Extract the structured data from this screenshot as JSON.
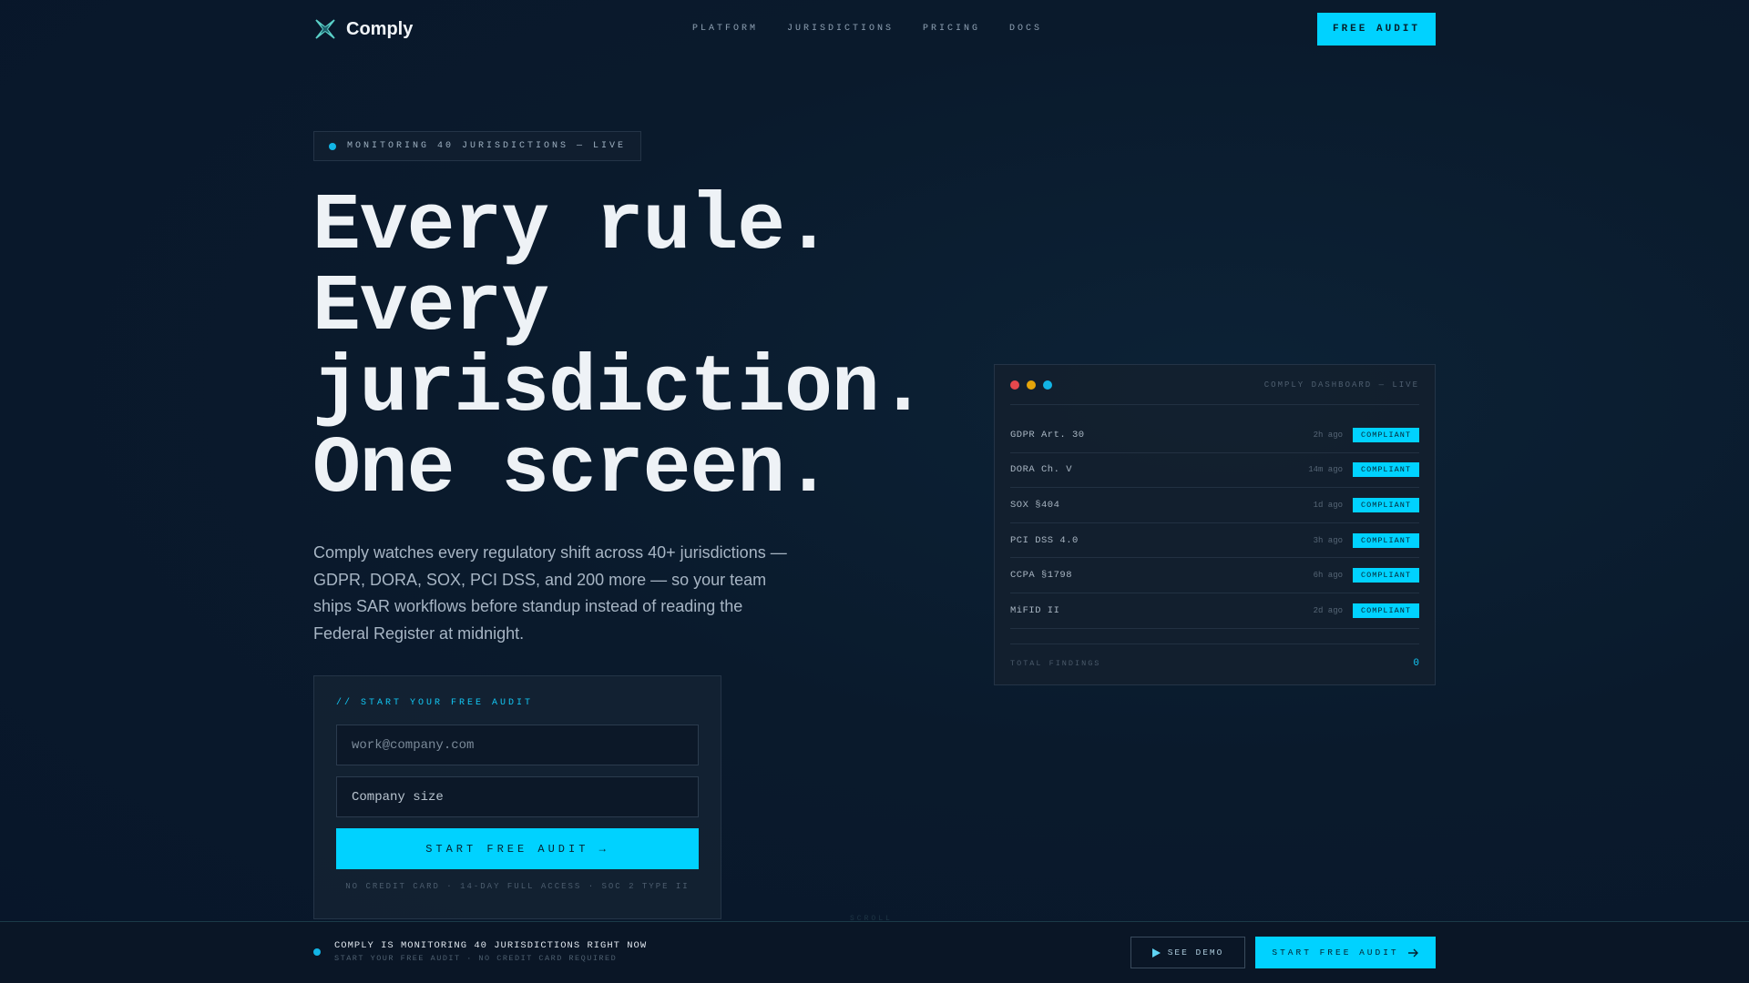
{
  "nav": {
    "brand": "Comply",
    "links": [
      "PLATFORM",
      "JURISDICTIONS",
      "PRICING",
      "DOCS"
    ],
    "cta": "FREE AUDIT"
  },
  "hero": {
    "badge": "MONITORING 40 JURISDICTIONS — LIVE",
    "headline": [
      "Every rule.",
      "Every",
      "jurisdiction.",
      "One screen."
    ],
    "lede": "Comply watches every regulatory shift across 40+ jurisdictions — GDPR, DORA, SOX, PCI DSS, and 200 more — so your team ships SAR workflows before standup instead of reading the Federal Register at midnight."
  },
  "form": {
    "label": "// START YOUR FREE AUDIT",
    "email_placeholder": "work@company.com",
    "size_placeholder": "Company size",
    "submit": "START FREE AUDIT →",
    "fine_print": "NO CREDIT CARD · 14-DAY FULL ACCESS · SOC 2 TYPE II"
  },
  "dashboard": {
    "title": "COMPLY DASHBOARD — LIVE",
    "dot_colors": [
      "#e5484d",
      "#e5a50a",
      "#12b5e6"
    ],
    "rows": [
      {
        "name": "GDPR Art. 30",
        "time": "2h ago",
        "status": "COMPLIANT"
      },
      {
        "name": "DORA Ch. V",
        "time": "14m ago",
        "status": "COMPLIANT"
      },
      {
        "name": "SOX §404",
        "time": "1d ago",
        "status": "COMPLIANT"
      },
      {
        "name": "PCI DSS 4.0",
        "time": "3h ago",
        "status": "COMPLIANT"
      },
      {
        "name": "CCPA §1798",
        "time": "6h ago",
        "status": "COMPLIANT"
      },
      {
        "name": "MiFID II",
        "time": "2d ago",
        "status": "COMPLIANT"
      }
    ],
    "footer_label": "TOTAL FINDINGS",
    "footer_value": "0"
  },
  "scroll_hint": "SCROLL",
  "bottom_bar": {
    "title": "COMPLY IS MONITORING 40 JURISDICTIONS RIGHT NOW",
    "subtitle": "START YOUR FREE AUDIT · NO CREDIT CARD REQUIRED",
    "demo_button": "SEE DEMO",
    "start_button": "START FREE AUDIT"
  },
  "colors": {
    "accent": "#00d2ff",
    "background": "#0a1a2c"
  }
}
